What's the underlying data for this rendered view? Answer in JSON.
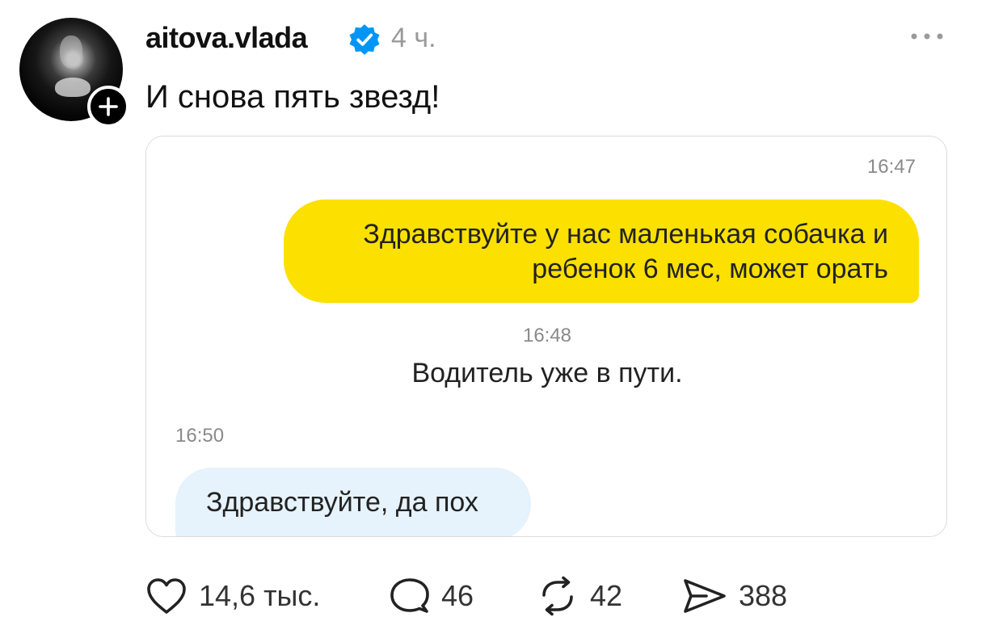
{
  "post": {
    "username": "aitova.vlada",
    "time_ago": "4 ч.",
    "text": "И снова пять звезд!"
  },
  "chat": {
    "messages": [
      {
        "time": "16:47",
        "type": "outgoing",
        "text": "Здравствуйте у нас маленькая собачка и ребенок 6 мес, может орать"
      },
      {
        "time": "16:48",
        "type": "system",
        "text": "Водитель уже в пути."
      },
      {
        "time": "16:50",
        "type": "incoming",
        "text": "Здравствуйте, да пох"
      }
    ]
  },
  "actions": {
    "likes": "14,6 тыс.",
    "comments": "46",
    "reposts": "42",
    "shares": "388"
  },
  "icons": [
    "follow-plus-icon",
    "verified-icon",
    "more-icon",
    "heart-icon",
    "comment-icon",
    "repost-icon",
    "share-icon"
  ],
  "colors": {
    "outgoing_bubble": "#fce000",
    "incoming_bubble": "#e6f2fc",
    "verified": "#0095f6",
    "time_gray": "#9a9a9a"
  }
}
